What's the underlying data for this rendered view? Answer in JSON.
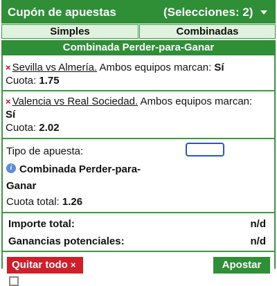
{
  "header": {
    "title": "Cupón de apuestas",
    "selections": "(Selecciones: 2)"
  },
  "tabs": [
    {
      "label": "Simples"
    },
    {
      "label": "Combinadas"
    }
  ],
  "subheader": "Combinada Perder-para-Ganar",
  "selections": [
    {
      "event": "Sevilla vs Almería.",
      "market": "Ambos equipos marcan:",
      "pick": "Sí",
      "odds_label": "Cuota:",
      "odds": "1.75"
    },
    {
      "event": "Valencia vs Real Sociedad.",
      "market": "Ambos equipos marcan:",
      "pick": "Sí",
      "odds_label": "Cuota:",
      "odds": "2.02"
    }
  ],
  "bet_type": {
    "label": "Tipo de apuesta:",
    "name_line1": "Combinada Perder-para-",
    "name_line2": "Ganar"
  },
  "total_odds": {
    "label": "Cuota total:",
    "value": "1.26"
  },
  "summary": {
    "importe_label": "Importe total:",
    "importe_value": "n/d",
    "ganancias_label": "Ganancias potenciales:",
    "ganancias_value": "n/d"
  },
  "buttons": {
    "clear": "Quitar todo",
    "clear_icon": "×",
    "bet": "Apostar"
  },
  "icons": {
    "remove": "×",
    "info": "i"
  },
  "colors": {
    "brand": "#2f8f37",
    "tab_bg": "#dff2dd",
    "danger": "#cf1f2a",
    "focus": "#2a57c8",
    "info": "#5b8ed6"
  }
}
